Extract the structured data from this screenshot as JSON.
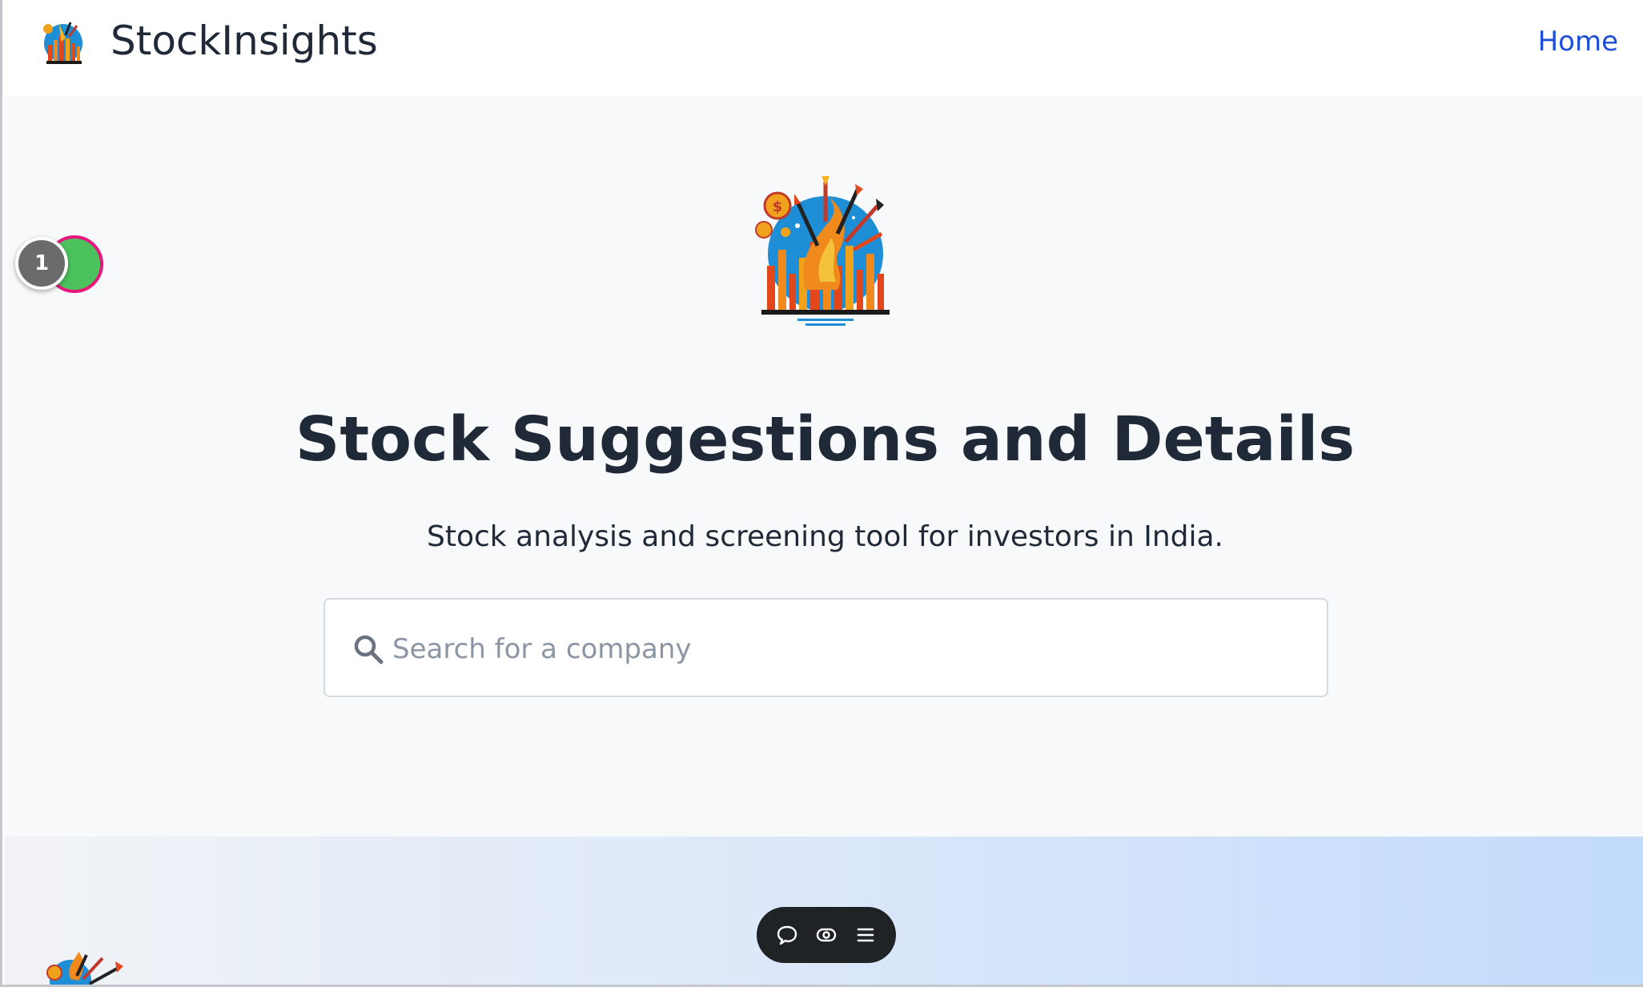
{
  "navbar": {
    "brand": "StockInsights",
    "home_link": "Home"
  },
  "hero": {
    "title": "Stock Suggestions and Details",
    "subtitle": "Stock analysis and screening tool for investors in India."
  },
  "search": {
    "placeholder": "Search for a company",
    "value": ""
  },
  "badge": {
    "count": "1"
  },
  "toolbar": {
    "icons": [
      "chat-icon",
      "eye-icon",
      "menu-icon"
    ]
  },
  "colors": {
    "link": "#1d4ed8",
    "text": "#1f2937",
    "hero_bg": "#f8f9fa",
    "toolbar_bg": "#1f2326",
    "badge_green": "#4cc25c",
    "badge_ring": "#e6177e",
    "badge_grey": "#6b6b6b"
  }
}
